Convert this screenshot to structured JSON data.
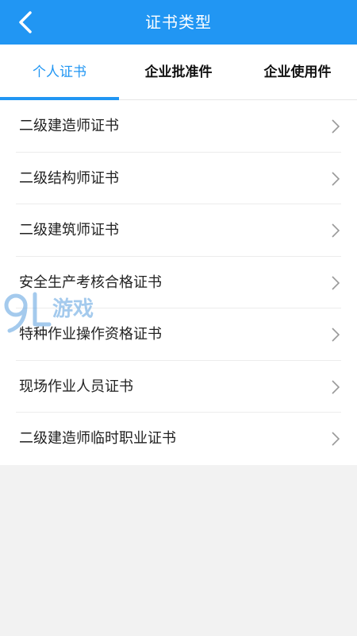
{
  "header": {
    "title": "证书类型",
    "back_icon": "chevron-left-icon"
  },
  "tabs": [
    {
      "label": "个人证书",
      "active": true
    },
    {
      "label": "企业批准件",
      "active": false
    },
    {
      "label": "企业使用件",
      "active": false
    }
  ],
  "list": {
    "items": [
      {
        "label": "二级建造师证书"
      },
      {
        "label": "二级结构师证书"
      },
      {
        "label": "二级建筑师证书"
      },
      {
        "label": "安全生产考核合格证书"
      },
      {
        "label": "特种作业操作资格证书"
      },
      {
        "label": "现场作业人员证书"
      },
      {
        "label": "二级建造师临时职业证书"
      }
    ],
    "chevron_icon": "chevron-right-icon"
  },
  "watermark": {
    "text": "游戏",
    "logo_text": "9L"
  },
  "colors": {
    "primary": "#2196f3",
    "background": "#f2f2f2",
    "text": "#222222"
  }
}
